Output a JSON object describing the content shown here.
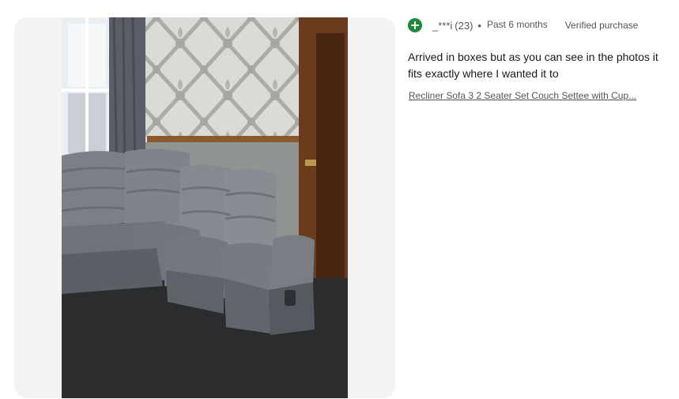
{
  "review": {
    "reviewer": {
      "username": "_***i",
      "feedback_score": "(23)",
      "icon": "plus-circle-icon",
      "icon_color": "#1f8a3a"
    },
    "separator": "•",
    "period": "Past 6 months",
    "verified_label": "Verified purchase",
    "comment": "Arrived in boxes but as you can see in the photos it fits exactly where I wanted it to",
    "item_title": "Recliner Sofa 3 2 Seater Set Couch Settee with Cup..."
  }
}
